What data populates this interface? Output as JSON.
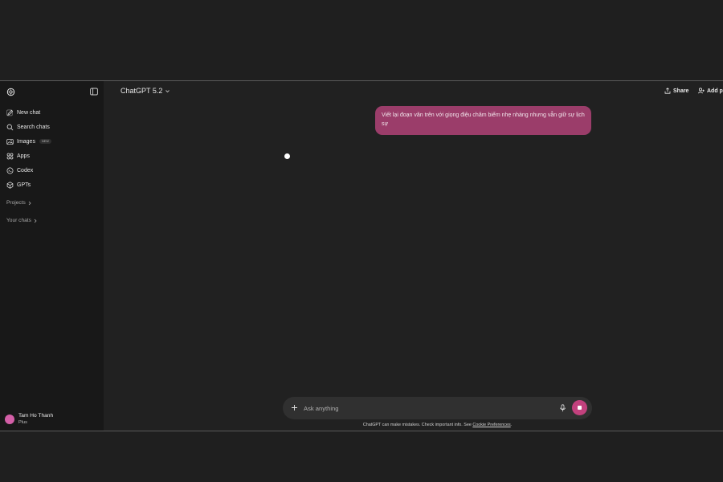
{
  "header": {
    "model_title": "ChatGPT 5.2",
    "share_label": "Share",
    "add_people_label": "Add p"
  },
  "sidebar": {
    "items": [
      {
        "label": "New chat",
        "icon": "new-chat-icon"
      },
      {
        "label": "Search chats",
        "icon": "search-icon"
      },
      {
        "label": "Images",
        "icon": "images-icon",
        "badge": "NEW"
      },
      {
        "label": "Apps",
        "icon": "apps-icon"
      },
      {
        "label": "Codex",
        "icon": "codex-icon"
      },
      {
        "label": "GPTs",
        "icon": "gpts-icon"
      }
    ],
    "projects_label": "Projects",
    "your_chats_label": "Your chats",
    "user": {
      "name": "Tam Ho Thanh",
      "plan": "Plus"
    }
  },
  "conversation": {
    "user_message": "Viết lại đoạn văn trên với giọng điệu châm biếm nhẹ nhàng nhưng vẫn giữ sự lịch sự"
  },
  "composer": {
    "placeholder": "Ask anything",
    "value": ""
  },
  "footer": {
    "disclaimer": "ChatGPT can make mistakes. Check important info. See ",
    "cookie_link": "Cookie Preferences",
    "suffix": "."
  },
  "colors": {
    "user_bubble": "#9b3d6a",
    "stop_button": "#c2417d",
    "avatar": "#d35fa7"
  }
}
